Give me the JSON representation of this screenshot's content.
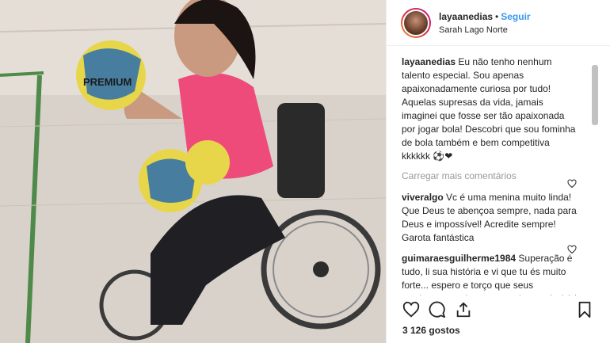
{
  "header": {
    "username": "layaanedias",
    "separator": "•",
    "follow": "Seguir",
    "location": "Sarah Lago Norte"
  },
  "caption": {
    "username": "layaanedias",
    "text": "Eu não tenho nenhum talento especial. Sou apenas apaixonadamente curiosa por tudo! Aquelas supresas da vida, jamais imaginei que fosse ser tão apaixonada por jogar bola! Descobri que sou fominha de bola também e bem competitiva kkkkkk",
    "emojis": "⚽❤"
  },
  "load_more": "Carregar mais comentários",
  "comments": [
    {
      "username": "viveralgo",
      "text": "Vc é uma menina muito linda! Que Deus te abençoa sempre, nada para Deus e impossível! Acredite sempre! Garota fantástica"
    },
    {
      "username": "guimaraesguilherme1984",
      "text": "Superação é tudo, li sua história e vi que tu és muito forte... espero e torço que seus movimentos voltem caso seja possível (vi que relatou q existe está possibilidade). Grande beijo e seja feliz. Sou teu fã",
      "emoji": "😍"
    }
  ],
  "likes": "3 126 gostos",
  "ball_brand": "PREMIUM",
  "icons": [
    "heart-icon",
    "comment-icon",
    "share-icon",
    "bookmark-icon"
  ],
  "colors": {
    "follow": "#3897f0",
    "muted": "#999999",
    "text": "#262626",
    "shirt": "#ef4b7a"
  }
}
